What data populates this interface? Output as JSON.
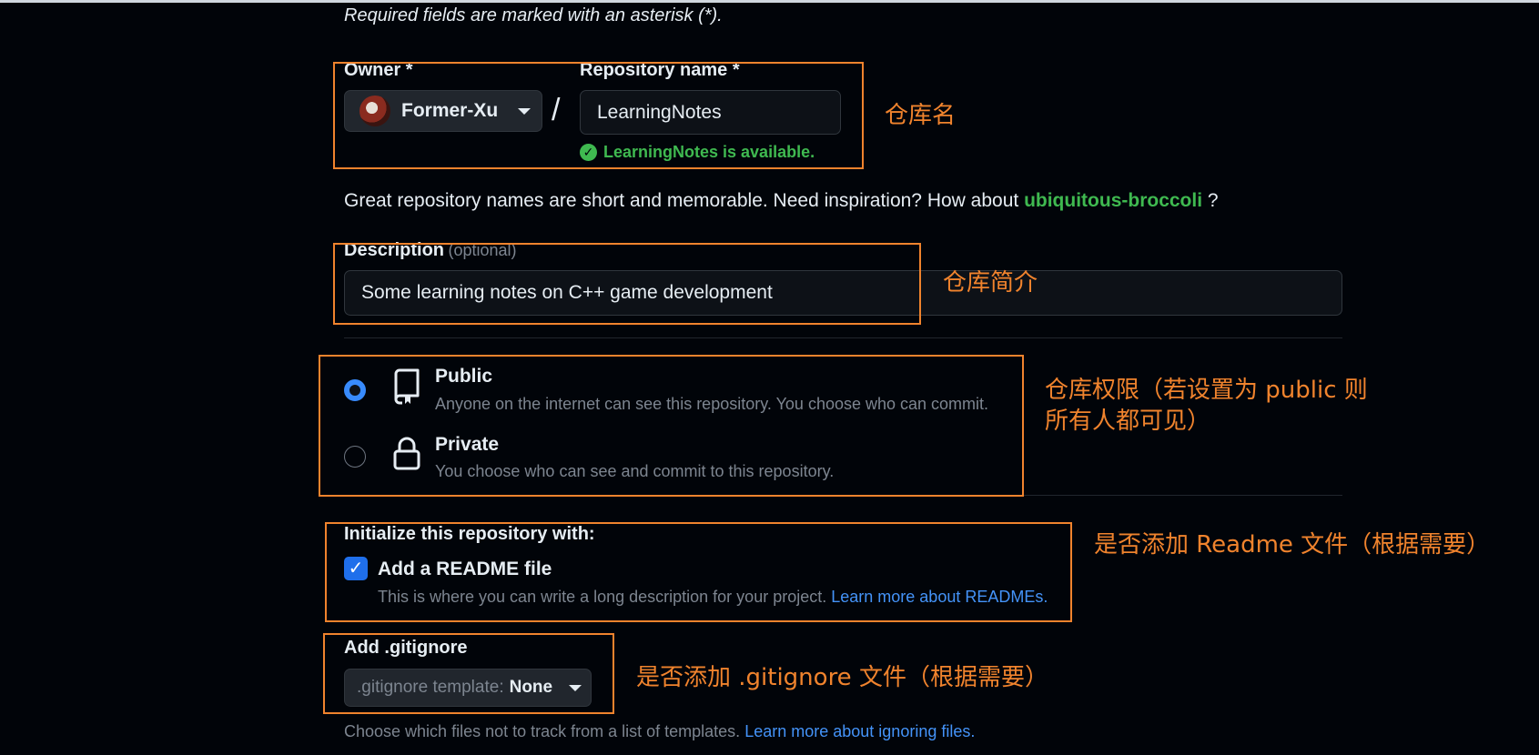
{
  "form": {
    "required_note": "Required fields are marked with an asterisk (*).",
    "owner_label": "Owner *",
    "owner_value": "Former-Xu",
    "separator": "/",
    "repo_name_label": "Repository name *",
    "repo_name_value": "LearningNotes",
    "availability": "LearningNotes is available.",
    "name_hint": "Great repository names are short and memorable. Need inspiration? How about",
    "name_suggestion": "ubiquitous-broccoli",
    "name_hint_end": "?",
    "description_label": "Description",
    "description_optional": "(optional)",
    "description_value": "Some learning notes on C++ game development"
  },
  "visibility": {
    "options": [
      {
        "title": "Public",
        "subtitle": "Anyone on the internet can see this repository. You choose who can commit.",
        "selected": true,
        "icon": "repo-icon"
      },
      {
        "title": "Private",
        "subtitle": "You choose who can see and commit to this repository.",
        "selected": false,
        "icon": "lock-icon"
      }
    ]
  },
  "initialize": {
    "heading": "Initialize this repository with:",
    "readme_label": "Add a README file",
    "readme_checked": true,
    "readme_desc": "This is where you can write a long description for your project.",
    "readme_link": "Learn more about READMEs."
  },
  "gitignore": {
    "heading": "Add .gitignore",
    "select_prefix": ".gitignore template:",
    "select_value": "None",
    "desc": "Choose which files not to track from a list of templates.",
    "link": "Learn more about ignoring files."
  },
  "annotations": {
    "repo_name": "仓库名",
    "description": "仓库简介",
    "visibility_line1": "仓库权限（若设置为 public 则",
    "visibility_line2": "所有人都可见）",
    "readme": "是否添加 Readme 文件（根据需要）",
    "gitignore": "是否添加 .gitignore 文件（根据需要）",
    "highlight_color": "#f0832d"
  },
  "colors": {
    "background": "#010409",
    "success": "#3fb950",
    "link": "#4493f8",
    "accent": "#1f6feb"
  }
}
